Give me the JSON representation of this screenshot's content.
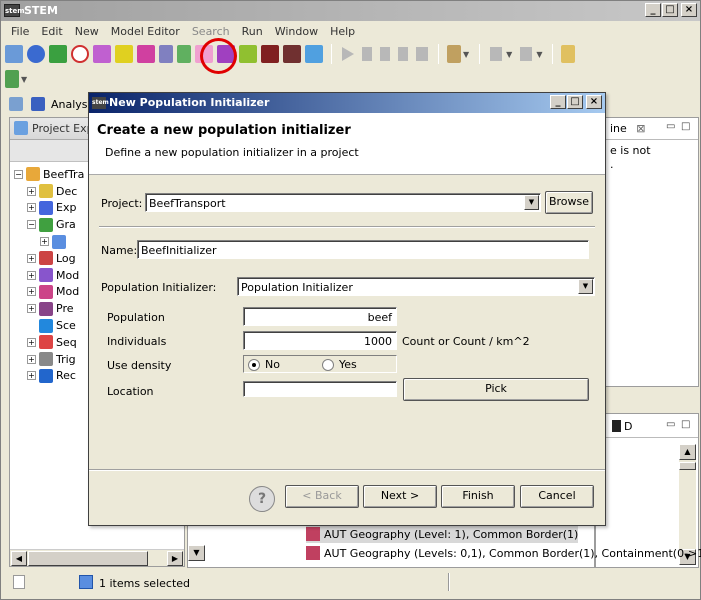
{
  "app": {
    "title": "STEM",
    "logo_text": "stem",
    "menu": [
      "File",
      "Edit",
      "New",
      "Model Editor",
      "Search",
      "Run",
      "Window",
      "Help"
    ],
    "menu_disabled": [
      "Search"
    ],
    "perspective_label": "Analysis"
  },
  "project_explorer": {
    "tab_label": "Project Expl",
    "tree": [
      {
        "label": "BeefTra",
        "expander": "−",
        "indent": 0,
        "icon": "project-folder-icon",
        "color": "#e8a83a"
      },
      {
        "label": "Dec",
        "expander": "+",
        "indent": 1,
        "icon": "decorators-icon",
        "color": "#e0c040"
      },
      {
        "label": "Exp",
        "expander": "+",
        "indent": 1,
        "icon": "experiments-icon",
        "color": "#4466dd"
      },
      {
        "label": "Gra",
        "expander": "−",
        "indent": 1,
        "icon": "graphs-icon",
        "color": "#40a040"
      },
      {
        "label": "",
        "expander": "+",
        "indent": 2,
        "icon": "graph-file-icon",
        "color": "#5a8ee0"
      },
      {
        "label": "Log",
        "expander": "+",
        "indent": 1,
        "icon": "loggers-icon",
        "color": "#cc4444"
      },
      {
        "label": "Mod",
        "expander": "+",
        "indent": 1,
        "icon": "models-icon",
        "color": "#8855cc"
      },
      {
        "label": "Mod",
        "expander": "+",
        "indent": 1,
        "icon": "modifiers-icon",
        "color": "#cc4488"
      },
      {
        "label": "Pre",
        "expander": "+",
        "indent": 1,
        "icon": "predicates-icon",
        "color": "#884488"
      },
      {
        "label": "Sce",
        "expander": "",
        "indent": 1,
        "icon": "scenarios-icon",
        "color": "#2288dd"
      },
      {
        "label": "Seq",
        "expander": "+",
        "indent": 1,
        "icon": "sequencers-icon",
        "color": "#dd4444"
      },
      {
        "label": "Trig",
        "expander": "+",
        "indent": 1,
        "icon": "triggers-icon",
        "color": "#888888"
      },
      {
        "label": "Rec",
        "expander": "+",
        "indent": 1,
        "icon": "recorded-simulations-icon",
        "color": "#2266cc"
      }
    ]
  },
  "right_top": {
    "tab_label": "ine",
    "tab_close": "⊠",
    "text_lines": [
      "e is not",
      "."
    ]
  },
  "right_bottom": {
    "tab_label": "D"
  },
  "bottom_list": {
    "items": [
      {
        "label": "AUT Geography (Level: 1), Common Border(1)",
        "selected": true
      },
      {
        "label": "AUT Geography (Levels: 0,1), Common Border(1), Containment(0->1)",
        "selected": false
      }
    ]
  },
  "status": {
    "text": "1 items selected"
  },
  "dialog": {
    "title": "New Population Initializer",
    "heading": "Create a new population initializer",
    "subheading": "Define a new population initializer in a project",
    "project_label": "Project:",
    "project_value": "BeefTransport",
    "browse_label": "Browse",
    "name_label": "Name:",
    "name_value": "BeefInitializer",
    "initializer_label": "Population Initializer:",
    "initializer_value": "Population Initializer",
    "population_label": "Population",
    "population_value": "beef",
    "individuals_label": "Individuals",
    "individuals_value": "1000",
    "individuals_unit": "Count or Count / km^2",
    "density_label": "Use density",
    "density_no": "No",
    "density_yes": "Yes",
    "density_selected": "No",
    "location_label": "Location",
    "location_value": "",
    "pick_label": "Pick",
    "help_glyph": "?",
    "back_label": "< Back",
    "next_label": "Next >",
    "finish_label": "Finish",
    "cancel_label": "Cancel"
  },
  "window_buttons": {
    "minimize": "_",
    "maximize": "□",
    "close": "×"
  }
}
